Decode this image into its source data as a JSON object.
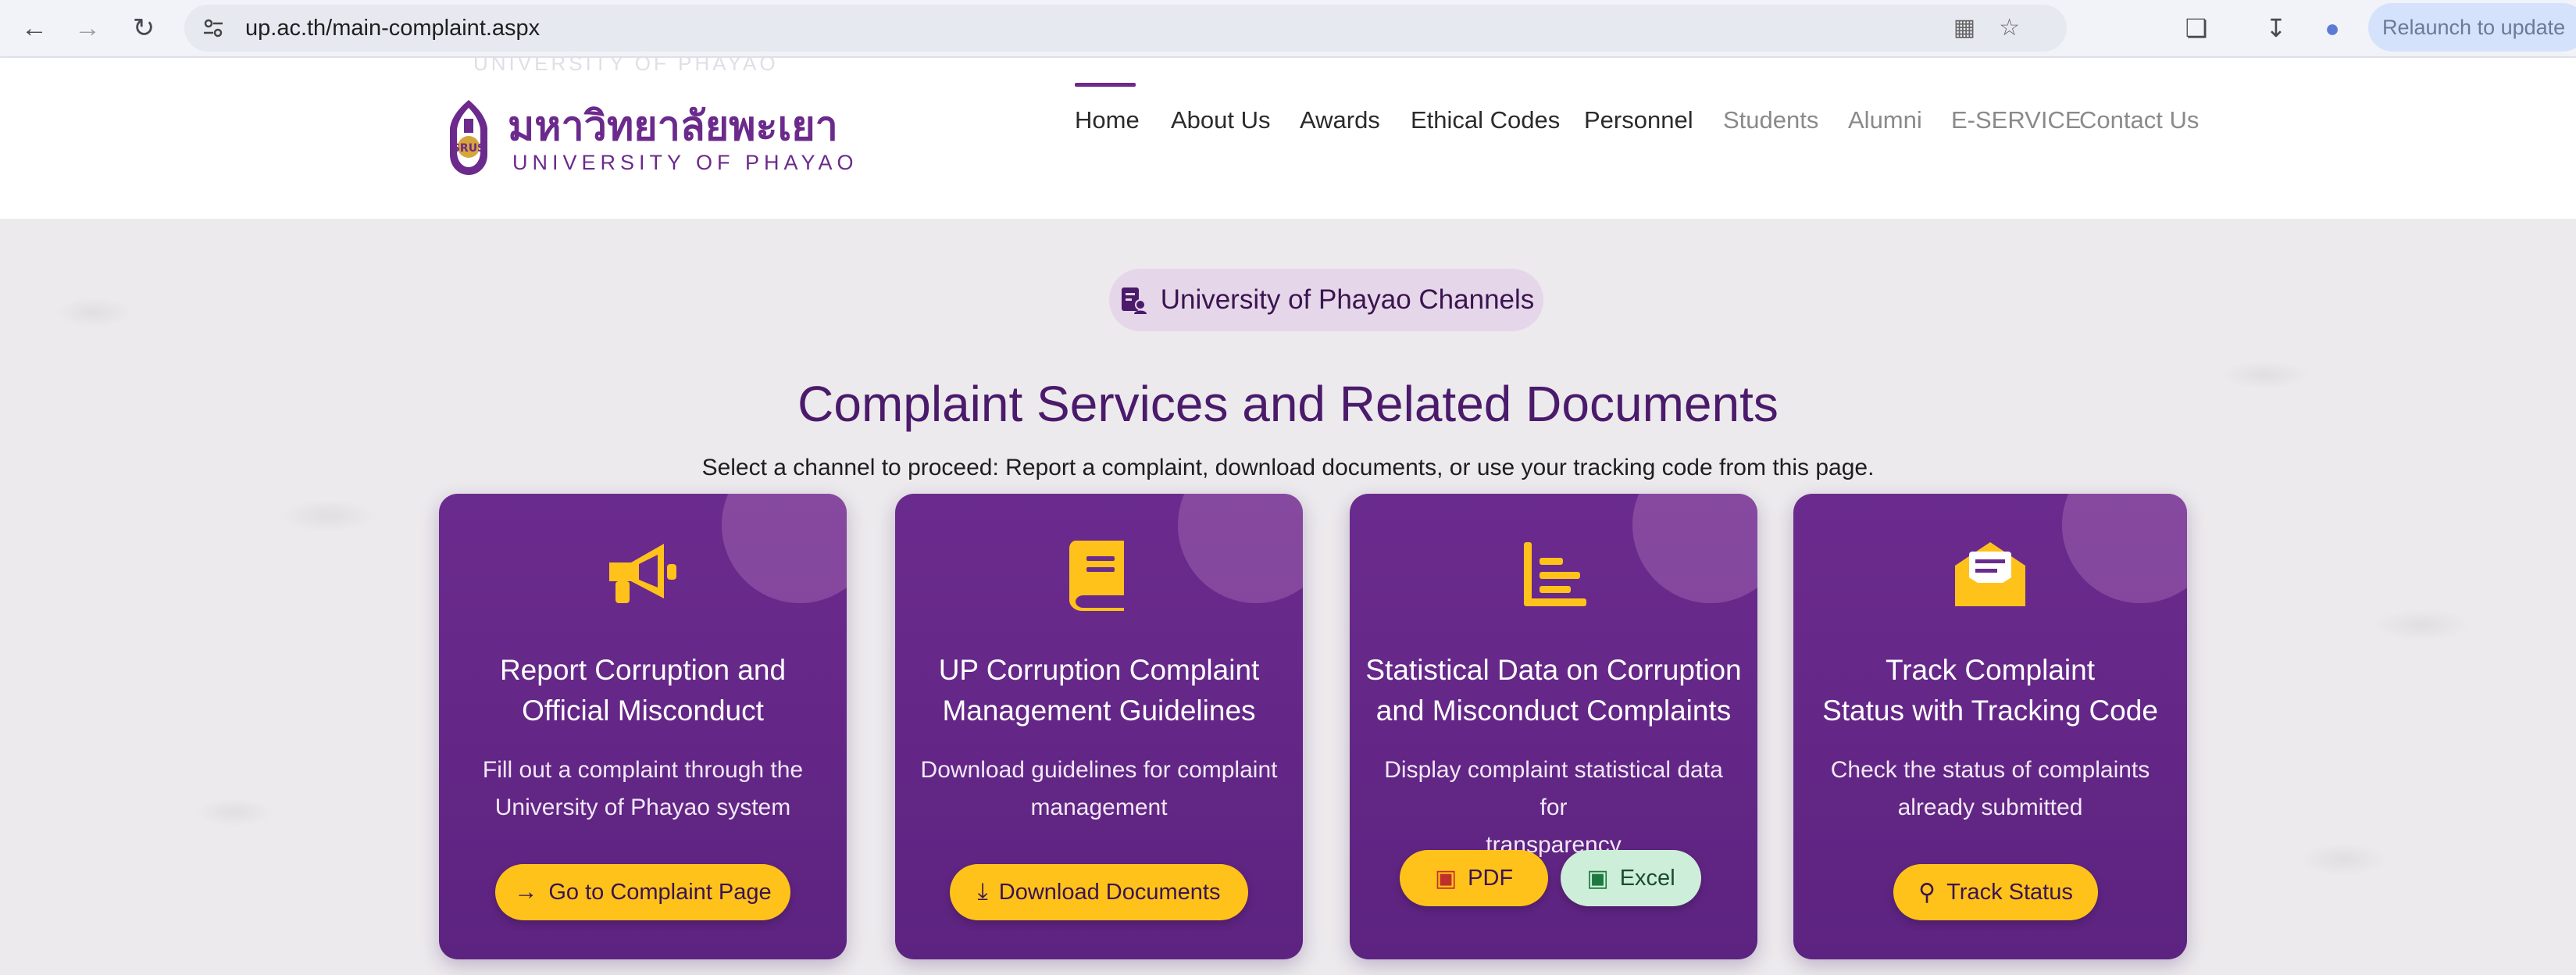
{
  "browser": {
    "url": "up.ac.th/main-complaint.aspx",
    "relaunch_label": "Relaunch to update"
  },
  "header": {
    "ghost_brand": "UNIVERSITY OF PHAYAO",
    "logo_thai": "มหาวิทยาลัยพะเยา",
    "logo_en": "UNIVERSITY OF PHAYAO",
    "seal_text": "SRUS",
    "menu": [
      {
        "label": "Home"
      },
      {
        "label": "About Us"
      },
      {
        "label": "Awards"
      },
      {
        "label": "Ethical Codes"
      },
      {
        "label": "Personnel"
      },
      {
        "label": "Students"
      },
      {
        "label": "Alumni"
      },
      {
        "label": "E-SERVICE"
      },
      {
        "label": "Contact Us"
      }
    ]
  },
  "hero": {
    "pill_label": "University of Phayao Channels",
    "title": "Complaint Services and Related Documents",
    "subtitle": "Select a channel to proceed: Report a complaint, download documents, or use your tracking code from this page."
  },
  "cards": [
    {
      "title_line1": "Report Corruption and",
      "title_line2": "Official Misconduct",
      "desc_line1": "Fill out a complaint through the",
      "desc_line2": "University of Phayao system",
      "button": "Go to Complaint Page"
    },
    {
      "title_line1": "UP Corruption Complaint",
      "title_line2": "Management Guidelines",
      "desc_line1": "Download guidelines for complaint",
      "desc_line2": "management",
      "button": "Download Documents"
    },
    {
      "title_line1": "Statistical Data on Corruption",
      "title_line2": "and Misconduct Complaints",
      "desc_line1": "Display complaint statistical data for",
      "desc_line2": "transparency",
      "button_pdf": "PDF",
      "button_excel": "Excel"
    },
    {
      "title_line1": "Track Complaint",
      "title_line2": "Status with Tracking Code",
      "desc_line1": "Check the status of complaints",
      "desc_line2": "already submitted",
      "button": "Track Status"
    }
  ],
  "colors": {
    "brand_purple": "#6b2a8c",
    "card_purple": "#652889",
    "accent_yellow": "#ffc21a",
    "excel_green": "#cdeed8"
  }
}
